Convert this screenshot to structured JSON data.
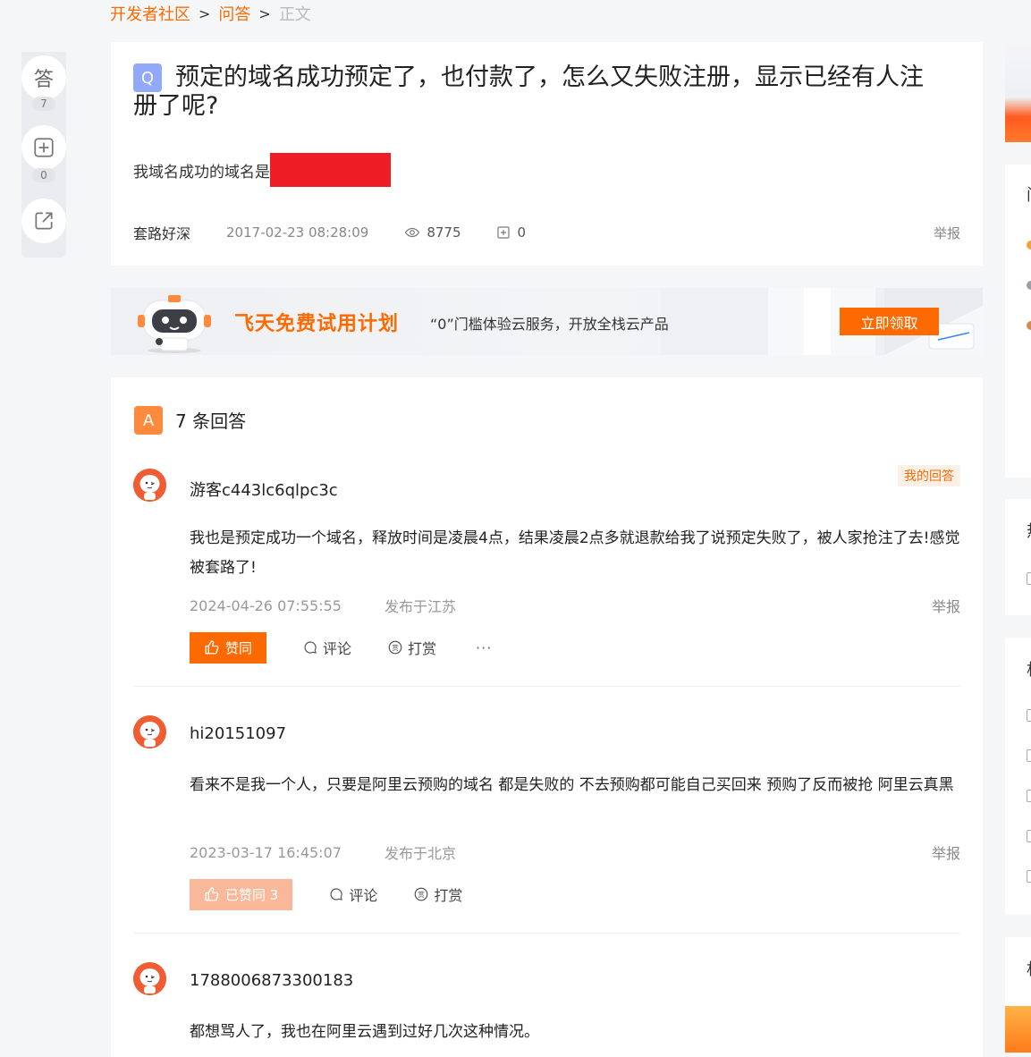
{
  "breadcrumb": {
    "home": "开发者社区",
    "sep": ">",
    "qa": "问答",
    "current": "正文"
  },
  "toolbar": {
    "answer_label": "答",
    "answer_count": "7",
    "follow_count": "0"
  },
  "question": {
    "badge": "Q",
    "title": "预定的域名成功预定了，也付款了，怎么又失败注册，显示已经有人注册了呢?",
    "body": "我域名成功的域名是",
    "author": "套路好深",
    "date": "2017-02-23 08:28:09",
    "views": "8775",
    "follows": "0",
    "report": "举报"
  },
  "banner": {
    "title": "飞天免费试用计划",
    "subtitle": "“0”门槛体验云服务，开放全栈云产品",
    "button": "立即领取"
  },
  "answers_section": {
    "badge": "A",
    "count_label": "7 条回答"
  },
  "answers": [
    {
      "user": "游客c443lc6qlpc3c",
      "tag": "我的回答",
      "text": "我也是预定成功一个域名，释放时间是凌晨4点，结果凌晨2点多就退款给我了说预定失败了，被人家抢注了去!感觉被套路了!",
      "date": "2024-04-26 07:55:55",
      "location": "发布于江苏",
      "report": "举报",
      "like_label": "赞同",
      "comment_label": "评论",
      "reward_label": "打赏",
      "more": "···"
    },
    {
      "user": "hi20151097",
      "text": "看来不是我一个人，只要是阿里云预购的域名 都是失败的 不去预购都可能自己买回来 预购了反而被抢 阿里云真黑",
      "date": "2023-03-17 16:45:07",
      "location": "发布于北京",
      "report": "举报",
      "like_label": "已赞同 3",
      "comment_label": "评论",
      "reward_label": "打赏"
    },
    {
      "user": "1788006873300183",
      "text": "都想骂人了，我也在阿里云遇到过好几次这种情况。"
    }
  ],
  "colors": {
    "accent": "#ff6a00",
    "liked": "#f8b899",
    "q_badge": "#91a9f8",
    "a_badge": "#ff8a3d",
    "redaction": "#ee1c24"
  }
}
